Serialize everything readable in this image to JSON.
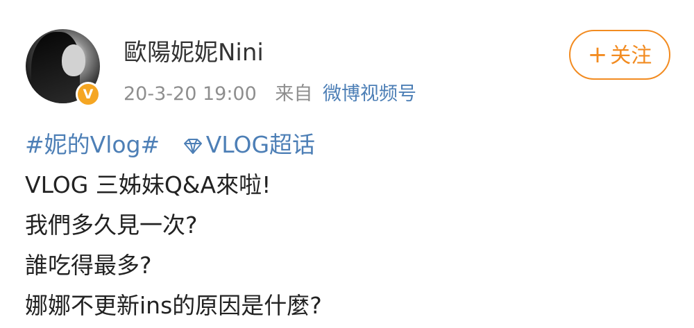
{
  "post": {
    "username": "歐陽妮妮Nini",
    "time": "20-3-20 19:00",
    "from_label": "来自",
    "source": "微博视频号",
    "verified_badge": "V",
    "follow_button": {
      "plus": "+",
      "label": "关注"
    },
    "hashtag": "#妮的Vlog#",
    "supertopic": "VLOG超话",
    "lines": [
      "VLOG 三姊妹Q&A來啦!",
      "我們多久見一次?",
      "誰吃得最多?",
      "娜娜不更新ins的原因是什麼?"
    ]
  },
  "colors": {
    "accent": "#f28b20",
    "link": "#4d7fb6",
    "badge": "#f5a623",
    "meta": "#8e8e8e"
  },
  "icons": {
    "verified": "verified-v-icon",
    "supertopic": "diamond-icon"
  }
}
